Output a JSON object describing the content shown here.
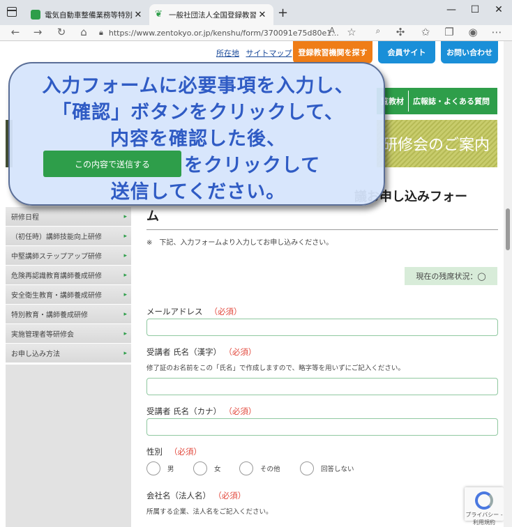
{
  "browser": {
    "tabs": [
      {
        "title": "電気自動車整備業務等特別教育",
        "active": false
      },
      {
        "title": "一般社団法人全国登録教習機関",
        "active": true
      }
    ],
    "new_tab": "+",
    "window_controls": {
      "minimize": "—",
      "maximize": "☐",
      "close": "✕"
    },
    "address_url": "https://www.zentokyo.or.jp/kenshu/form/370091e75d80e1..."
  },
  "header": {
    "links": [
      "所在地",
      "サイトマップ"
    ],
    "buttons": [
      "登録教習機関を探す",
      "会員サイト",
      "お問い合わせ"
    ],
    "nav": [
      "覧教材",
      "広報誌・よくある質問"
    ],
    "banner_text": "研修会のご案内"
  },
  "sidebar": {
    "items": [
      "研修日程",
      "（初任時）講師技能向上研修",
      "中堅講師ステップアップ研修",
      "危険再認識教育講師養成研修",
      "安全衛生教育・講師養成研修",
      "特別教育・講師養成研修",
      "実施管理者等研修会",
      "お申し込み方法"
    ]
  },
  "main": {
    "title_part": "議お申し込みフォー",
    "title_wrap": "ム",
    "note": "※　下記、入力フォームより入力してお申し込みください。",
    "status": "現在の残席状況：◯",
    "required_label": "（必須）",
    "fields": {
      "email": {
        "label": "メールアドレス"
      },
      "name_kanji": {
        "label": "受講者 氏名（漢字）",
        "help": "修了証のお名前をこの「氏名」で作成しますので、略字等を用いずにご記入ください。"
      },
      "name_kana": {
        "label": "受講者 氏名（カナ）"
      },
      "gender": {
        "label": "性別",
        "options": [
          "男",
          "女",
          "その他",
          "回答しない"
        ]
      },
      "company": {
        "label": "会社名（法人名）",
        "help": "所属する企業、法人名をご記入ください。"
      }
    }
  },
  "recaptcha": {
    "text": "プライバシー - 利用規約"
  },
  "overlay": {
    "lines": [
      "入力フォームに必要事項を入力し、",
      "「確認」ボタンをクリックして、",
      "内容を確認した後、",
      "をクリックして",
      "送信してください。"
    ],
    "send_button": "この内容で送信する"
  }
}
